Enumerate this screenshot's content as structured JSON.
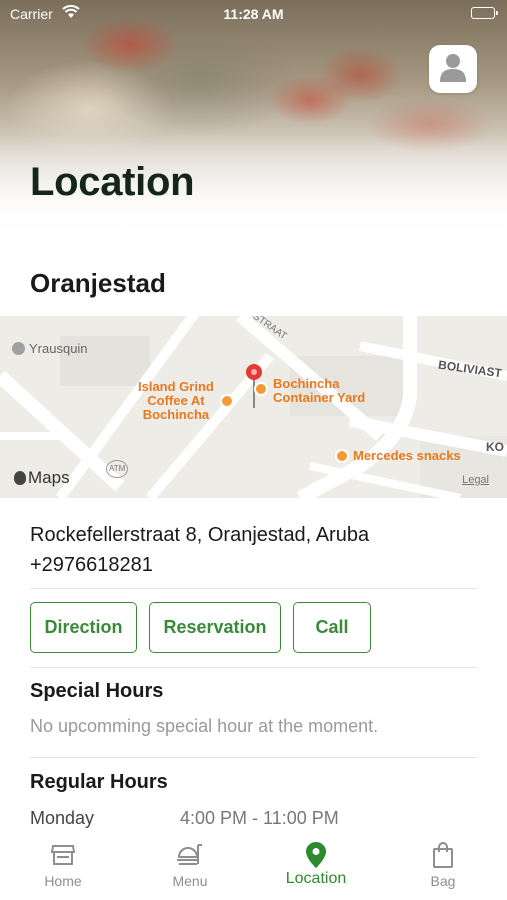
{
  "status_bar": {
    "carrier": "Carrier",
    "time": "11:28 AM"
  },
  "header": {
    "title": "Location"
  },
  "location": {
    "city": "Oranjestad",
    "address": "Rockefellerstraat 8, Oranjestad, Aruba",
    "phone": "+2976618281"
  },
  "map": {
    "labels": {
      "yrausquin": "Yrausquin",
      "island_grind": [
        "Island Grind",
        "Coffee At",
        "Bochincha"
      ],
      "bochincha": [
        "Bochincha",
        "Container Yard"
      ],
      "mercedes": "Mercedes snacks",
      "straat": "STRAAT",
      "boliviastr": "BOLIVIAST",
      "ko": "KO",
      "atm": "ATM",
      "maps": "Maps",
      "legal": "Legal"
    }
  },
  "actions": {
    "direction": "Direction",
    "reservation": "Reservation",
    "call": "Call"
  },
  "special_hours": {
    "title": "Special Hours",
    "note": "No upcomming special hour at the moment."
  },
  "regular_hours": {
    "title": "Regular Hours",
    "rows": [
      {
        "day": "Monday",
        "time": "4:00 PM - 11:00 PM"
      }
    ]
  },
  "tabs": [
    {
      "label": "Home",
      "icon": "store-icon",
      "active": false
    },
    {
      "label": "Menu",
      "icon": "menu-icon",
      "active": false
    },
    {
      "label": "Location",
      "icon": "location-pin-icon",
      "active": true
    },
    {
      "label": "Bag",
      "icon": "bag-icon",
      "active": false
    }
  ],
  "colors": {
    "accent": "#3a8a3a",
    "map_poi": "#e8791e",
    "title": "#14261a"
  }
}
